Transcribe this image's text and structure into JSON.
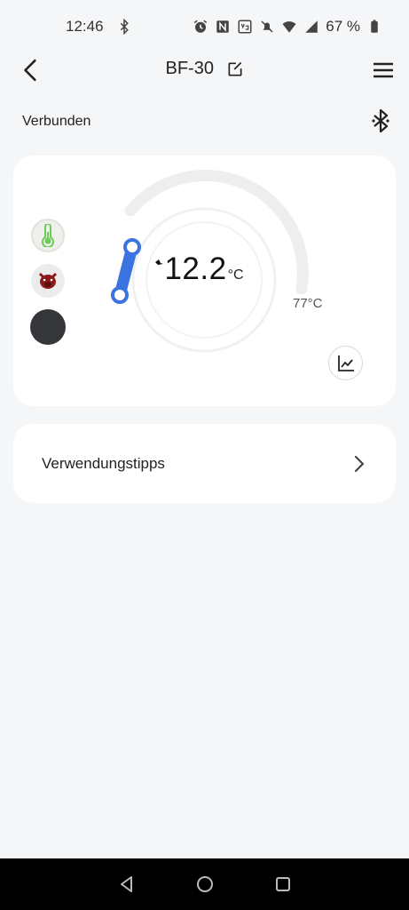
{
  "status_bar": {
    "time": "12:46",
    "battery": "67 %",
    "icons": [
      "bluetooth-icon",
      "alarm-icon",
      "nfc-icon",
      "volte-icon",
      "mute-icon",
      "wifi-icon",
      "signal-icon",
      "battery-icon"
    ]
  },
  "app_bar": {
    "title": "BF-30",
    "back_icon": "chevron-left-icon",
    "edit_icon": "edit-icon",
    "menu_icon": "menu-icon"
  },
  "connection": {
    "status": "Verbunden",
    "icon": "bluetooth-icon"
  },
  "thermometer": {
    "current_temp": "12.2",
    "unit": "°C",
    "target_temp": "77°C",
    "accent_color": "#3b74e0",
    "probes": [
      {
        "icon": "thermometer-icon",
        "color": "#6ecb5a"
      },
      {
        "icon": "boar-icon",
        "color": "#8b1a1a"
      },
      {
        "icon": "dark-circle-icon",
        "color": "#34363a"
      }
    ],
    "chart_icon": "line-chart-icon"
  },
  "tips": {
    "label": "Verwendungstipps",
    "arrow_icon": "chevron-right-icon"
  },
  "nav_bar": {
    "icons": [
      "back-triangle-icon",
      "home-circle-icon",
      "recents-square-icon"
    ]
  }
}
